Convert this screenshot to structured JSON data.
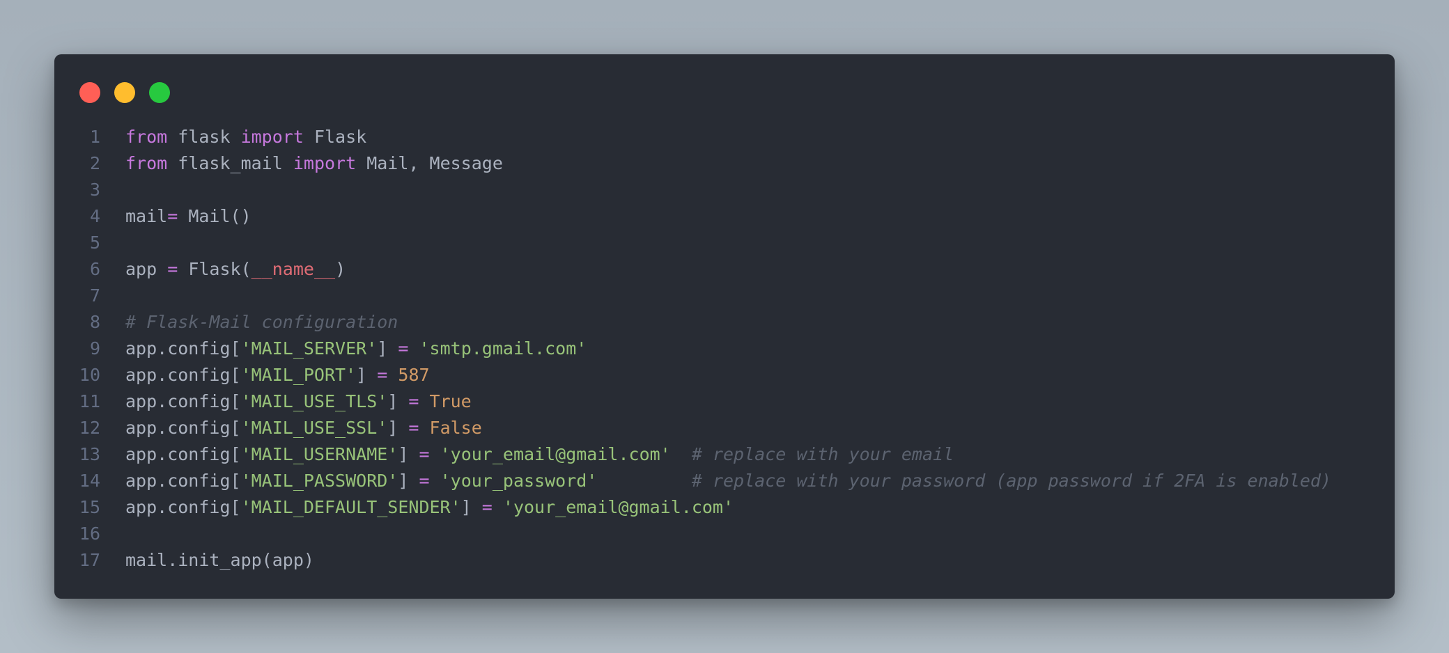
{
  "window": {
    "controls": [
      "close",
      "minimize",
      "maximize"
    ],
    "colors": {
      "close": "#ff5f56",
      "minimize": "#ffbd2e",
      "maximize": "#27c93f",
      "background": "#282c34"
    }
  },
  "code": {
    "language": "python",
    "lines": [
      {
        "n": "1",
        "tokens": [
          {
            "t": "kw",
            "v": "from"
          },
          {
            "t": "pl",
            "v": " flask "
          },
          {
            "t": "kw",
            "v": "import"
          },
          {
            "t": "pl",
            "v": " Flask"
          }
        ]
      },
      {
        "n": "2",
        "tokens": [
          {
            "t": "kw",
            "v": "from"
          },
          {
            "t": "pl",
            "v": " flask_mail "
          },
          {
            "t": "kw",
            "v": "import"
          },
          {
            "t": "pl",
            "v": " Mail, Message"
          }
        ]
      },
      {
        "n": "3",
        "tokens": []
      },
      {
        "n": "4",
        "tokens": [
          {
            "t": "pl",
            "v": "mail"
          },
          {
            "t": "op",
            "v": "="
          },
          {
            "t": "pl",
            "v": " Mail()"
          }
        ]
      },
      {
        "n": "5",
        "tokens": []
      },
      {
        "n": "6",
        "tokens": [
          {
            "t": "pl",
            "v": "app "
          },
          {
            "t": "op",
            "v": "="
          },
          {
            "t": "pl",
            "v": " Flask("
          },
          {
            "t": "dunder",
            "v": "__name__"
          },
          {
            "t": "pl",
            "v": ")"
          }
        ]
      },
      {
        "n": "7",
        "tokens": []
      },
      {
        "n": "8",
        "tokens": [
          {
            "t": "cm",
            "v": "# Flask-Mail configuration"
          }
        ]
      },
      {
        "n": "9",
        "tokens": [
          {
            "t": "pl",
            "v": "app.config["
          },
          {
            "t": "str",
            "v": "'MAIL_SERVER'"
          },
          {
            "t": "pl",
            "v": "] "
          },
          {
            "t": "op",
            "v": "="
          },
          {
            "t": "pl",
            "v": " "
          },
          {
            "t": "str",
            "v": "'smtp.gmail.com'"
          }
        ]
      },
      {
        "n": "10",
        "tokens": [
          {
            "t": "pl",
            "v": "app.config["
          },
          {
            "t": "str",
            "v": "'MAIL_PORT'"
          },
          {
            "t": "pl",
            "v": "] "
          },
          {
            "t": "op",
            "v": "="
          },
          {
            "t": "pl",
            "v": " "
          },
          {
            "t": "num",
            "v": "587"
          }
        ]
      },
      {
        "n": "11",
        "tokens": [
          {
            "t": "pl",
            "v": "app.config["
          },
          {
            "t": "str",
            "v": "'MAIL_USE_TLS'"
          },
          {
            "t": "pl",
            "v": "] "
          },
          {
            "t": "op",
            "v": "="
          },
          {
            "t": "pl",
            "v": " "
          },
          {
            "t": "num",
            "v": "True"
          }
        ]
      },
      {
        "n": "12",
        "tokens": [
          {
            "t": "pl",
            "v": "app.config["
          },
          {
            "t": "str",
            "v": "'MAIL_USE_SSL'"
          },
          {
            "t": "pl",
            "v": "] "
          },
          {
            "t": "op",
            "v": "="
          },
          {
            "t": "pl",
            "v": " "
          },
          {
            "t": "num",
            "v": "False"
          }
        ]
      },
      {
        "n": "13",
        "tokens": [
          {
            "t": "pl",
            "v": "app.config["
          },
          {
            "t": "str",
            "v": "'MAIL_USERNAME'"
          },
          {
            "t": "pl",
            "v": "] "
          },
          {
            "t": "op",
            "v": "="
          },
          {
            "t": "pl",
            "v": " "
          },
          {
            "t": "str",
            "v": "'your_email@gmail.com'"
          },
          {
            "t": "pl",
            "v": "  "
          },
          {
            "t": "cm",
            "v": "# replace with your email"
          }
        ]
      },
      {
        "n": "14",
        "tokens": [
          {
            "t": "pl",
            "v": "app.config["
          },
          {
            "t": "str",
            "v": "'MAIL_PASSWORD'"
          },
          {
            "t": "pl",
            "v": "] "
          },
          {
            "t": "op",
            "v": "="
          },
          {
            "t": "pl",
            "v": " "
          },
          {
            "t": "str",
            "v": "'your_password'"
          },
          {
            "t": "pl",
            "v": "         "
          },
          {
            "t": "cm",
            "v": "# replace with your password (app password if 2FA is enabled)"
          }
        ]
      },
      {
        "n": "15",
        "tokens": [
          {
            "t": "pl",
            "v": "app.config["
          },
          {
            "t": "str",
            "v": "'MAIL_DEFAULT_SENDER'"
          },
          {
            "t": "pl",
            "v": "] "
          },
          {
            "t": "op",
            "v": "="
          },
          {
            "t": "pl",
            "v": " "
          },
          {
            "t": "str",
            "v": "'your_email@gmail.com'"
          }
        ]
      },
      {
        "n": "16",
        "tokens": []
      },
      {
        "n": "17",
        "tokens": [
          {
            "t": "pl",
            "v": "mail.init_app(app)"
          }
        ]
      }
    ]
  }
}
